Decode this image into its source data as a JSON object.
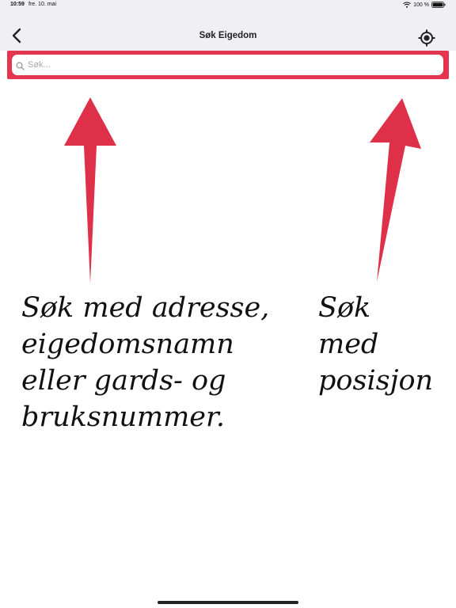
{
  "status_bar": {
    "time": "10:59",
    "date": "fre. 10. mai",
    "battery": "100 %"
  },
  "nav": {
    "title": "Søk Eigedom",
    "back_icon": "chevron-left-icon",
    "location_icon": "crosshair-location-icon"
  },
  "search": {
    "placeholder": "Søk..."
  },
  "hints": {
    "address": "Søk med adresse,\neigedomsnamn\neller gards- og\nbruksnummer.",
    "position": "Søk med\nposisjon"
  },
  "colors": {
    "accent": "#e5364f",
    "nav_background": "#efeff4"
  }
}
